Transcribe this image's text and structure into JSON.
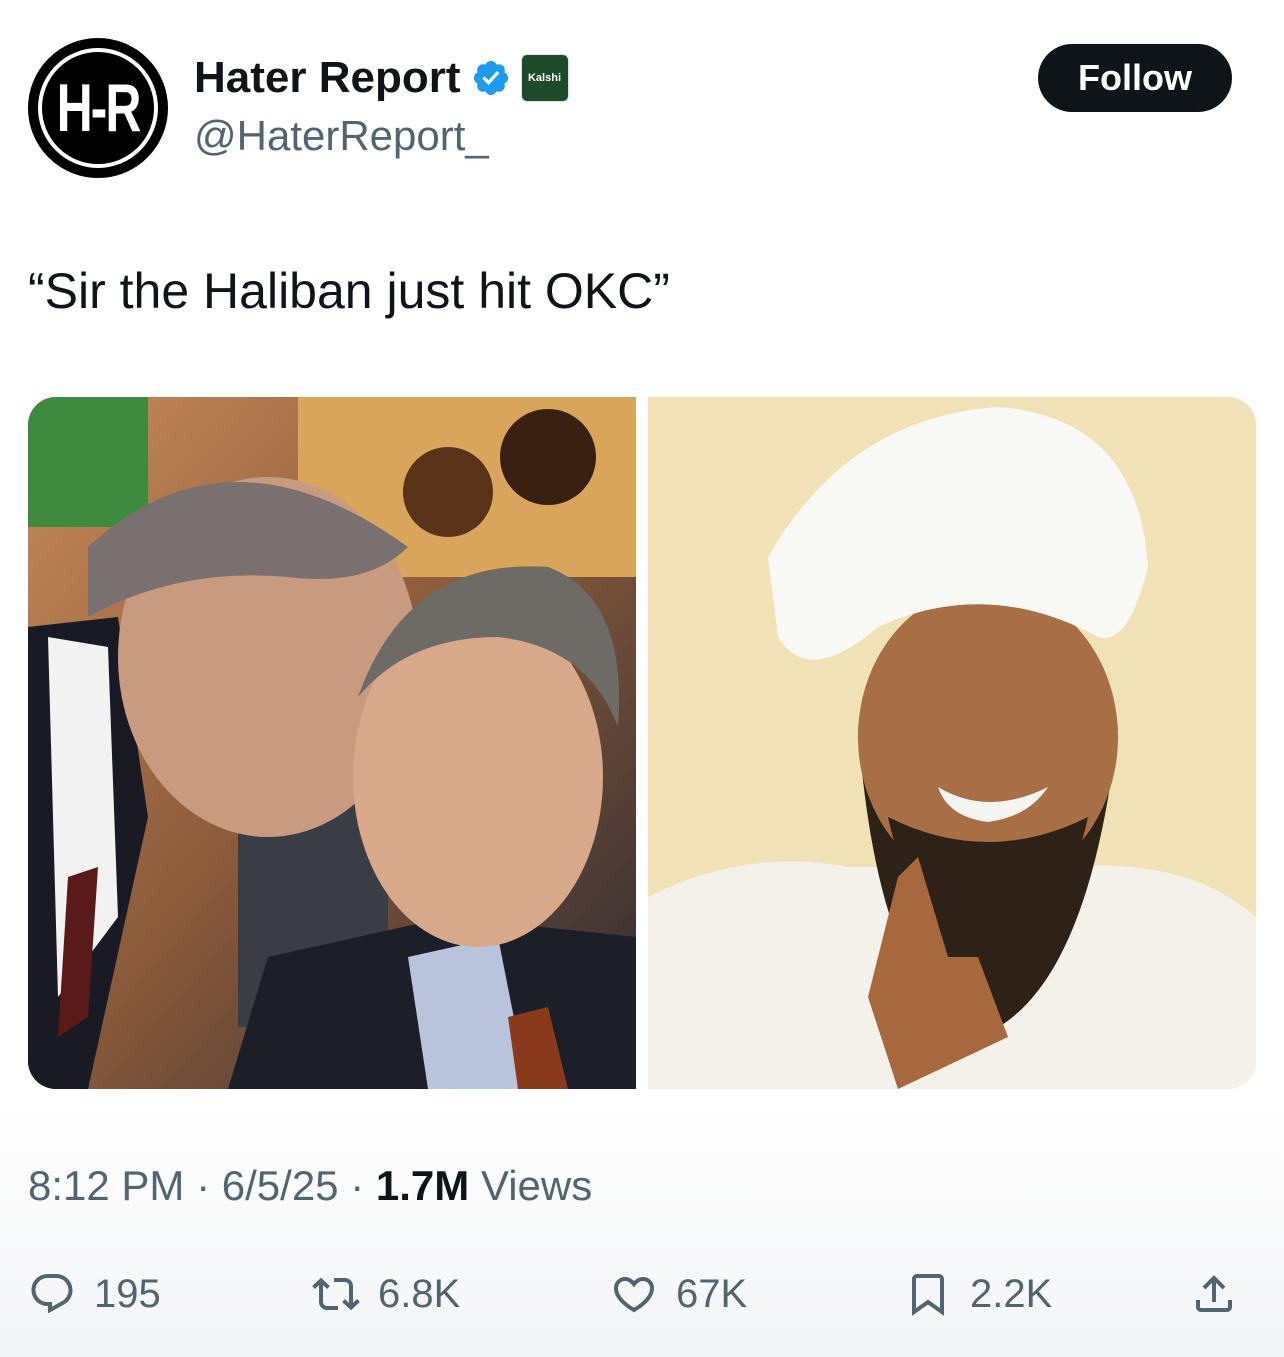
{
  "author": {
    "avatar_text": "H-R",
    "display_name": "Hater Report",
    "handle": "@HaterReport_",
    "verified": true,
    "affiliate_label": "Kalshi"
  },
  "follow_label": "Follow",
  "tweet": {
    "text": "“Sir the Haliban just hit OKC”"
  },
  "media": [
    {
      "icon": "photo-whisper-scene"
    },
    {
      "icon": "photo-man-turban"
    }
  ],
  "meta": {
    "time": "8:12 PM",
    "separator": "·",
    "date": "6/5/25",
    "views_count": "1.7M",
    "views_label": "Views"
  },
  "actions": {
    "replies": "195",
    "reposts": "6.8K",
    "likes": "67K",
    "bookmarks": "2.2K"
  },
  "colors": {
    "text": "#0f1419",
    "secondary": "#536471",
    "verified": "#1d9bf0",
    "follow_bg": "#0f1419"
  }
}
